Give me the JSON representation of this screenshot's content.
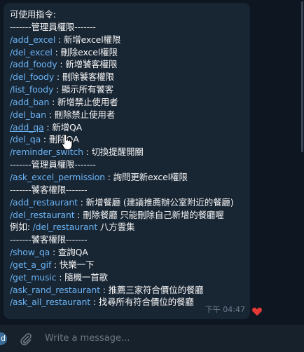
{
  "message": {
    "lines": [
      {
        "text": "可使用指令:"
      },
      {
        "text": "-------管理員權限-------"
      },
      {
        "cmd": "/add_excel",
        "text": " : 新增excel權限"
      },
      {
        "cmd": "/del_excel",
        "text": " : 刪除excel權限"
      },
      {
        "cmd": "/add_foody",
        "text": " : 新增饕客權限"
      },
      {
        "cmd": "/del_foody",
        "text": " : 刪除饕客權限"
      },
      {
        "cmd": "/list_foody",
        "text": " : 顯示所有饕客"
      },
      {
        "cmd": "/add_ban",
        "text": " : 新增禁止使用者"
      },
      {
        "cmd": "/del_ban",
        "text": " : 刪除禁止使用者"
      },
      {
        "cmd": "/add_qa",
        "text": " : 新增QA",
        "underline": true
      },
      {
        "cmd": "/del_qa",
        "text": " : 刪除QA"
      },
      {
        "cmd": "/reminder_switch",
        "text": " : 切換提醒開關"
      },
      {
        "text": "-------管理員權限-------"
      },
      {
        "cmd": "/ask_excel_permission",
        "text": " : 詢問更新excel權限"
      },
      {
        "text": "-------饕客權限-------"
      },
      {
        "cmd": "/add_restaurant",
        "text": " : 新增餐廳 (建議推薦辦公室附近的餐廳)"
      },
      {
        "cmd": "/del_restaurant",
        "text": " : 刪除餐廳 只能刪除自己新增的餐廳喔"
      },
      {
        "prefix": "例如: ",
        "cmd": "/del_restaurant",
        "text": " 八方雲集"
      },
      {
        "text": "-------饕客權限-------"
      },
      {
        "cmd": "/show_qa",
        "text": " : 查詢QA"
      },
      {
        "cmd": "/get_a_gif",
        "text": " : 快樂一下"
      },
      {
        "cmd": "/get_music",
        "text": " : 隨機一首歌"
      },
      {
        "cmd": "/ask_rand_restaurant",
        "text": " : 推薦三家符合價位的餐廳"
      },
      {
        "cmd": "/ask_all_restaurant",
        "text": " : 找尋所有符合價位的餐廳"
      }
    ],
    "time": "下午 04:47"
  },
  "reaction": {
    "icon": "heart-icon",
    "color": "#e53935"
  },
  "input": {
    "placeholder": "Write a message..."
  },
  "left_button": {
    "label": "d"
  },
  "colors": {
    "link": "#6ab3f3",
    "bubble": "#182533",
    "background": "#0e1621"
  }
}
